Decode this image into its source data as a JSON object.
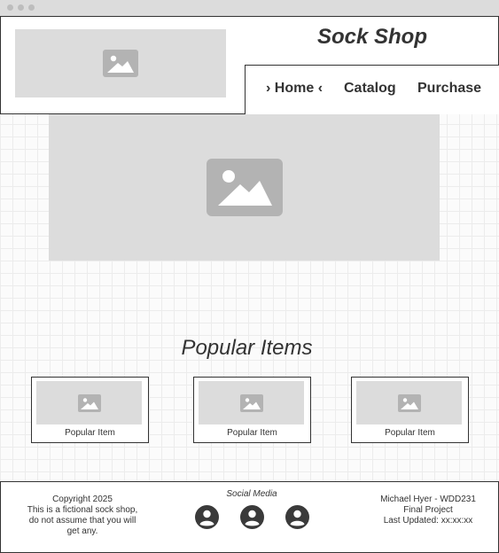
{
  "header": {
    "site_title": "Sock Shop",
    "nav": [
      {
        "label": "Home",
        "active": true
      },
      {
        "label": "Catalog"
      },
      {
        "label": "Purchase"
      }
    ],
    "active_prefix": "›",
    "active_suffix": "‹"
  },
  "popular": {
    "title": "Popular Items",
    "items": [
      {
        "label": "Popular Item"
      },
      {
        "label": "Popular Item"
      },
      {
        "label": "Popular Item"
      }
    ]
  },
  "footer": {
    "left": {
      "copyright": "Copyright 2025",
      "disclaimer": "This is a fictional sock shop, do not assume that you will get any."
    },
    "social_label": "Social Media",
    "social_icons": [
      "user-icon",
      "user-icon",
      "user-icon"
    ],
    "right": {
      "author": "Michael Hyer - WDD231",
      "project": "Final Project",
      "updated": "Last Updated: xx:xx:xx"
    }
  },
  "colors": {
    "placeholder": "#dcdcdc",
    "placeholder_icon": "#b3b3b3",
    "text": "#333333"
  }
}
